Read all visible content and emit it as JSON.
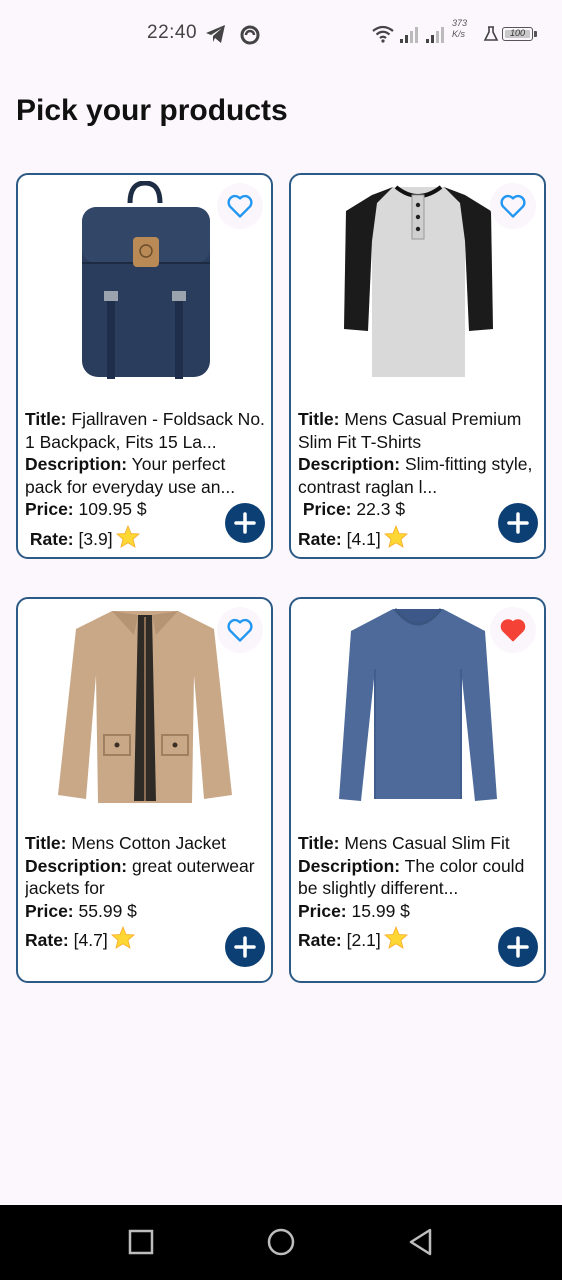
{
  "status_bar": {
    "time": "22:40",
    "net_speed_value": "373",
    "net_speed_unit": "K/s",
    "battery": "100"
  },
  "page": {
    "title": "Pick your products"
  },
  "labels": {
    "title": "Title:",
    "description": "Description:",
    "price": "Price:",
    "rate": "Rate:"
  },
  "products": [
    {
      "title": "Fjallraven - Foldsack No. 1 Backpack, Fits 15 La...",
      "description": "Your perfect pack for everyday use an...",
      "price": "109.95 $",
      "rate": "[3.9]",
      "favorite": false
    },
    {
      "title": "Mens Casual Premium Slim Fit T-Shirts",
      "description": "Slim-fitting style, contrast raglan l...",
      "price": "22.3 $",
      "rate": "[4.1]",
      "favorite": false
    },
    {
      "title": "Mens Cotton Jacket",
      "description": "great outerwear jackets for",
      "price": "55.99 $",
      "rate": "[4.7]",
      "favorite": false
    },
    {
      "title": "Mens Casual Slim Fit",
      "description": "The color could be slightly different...",
      "price": "15.99 $",
      "rate": "[2.1]",
      "favorite": true
    }
  ],
  "colors": {
    "card_border": "#2c5a86",
    "heart_outline": "#2196f3",
    "heart_filled": "#f44336",
    "add_button": "#0c3f73",
    "star": "#fdd835"
  },
  "icons": {
    "favorite": "heart-icon",
    "add": "plus-icon",
    "rating": "star-icon"
  }
}
